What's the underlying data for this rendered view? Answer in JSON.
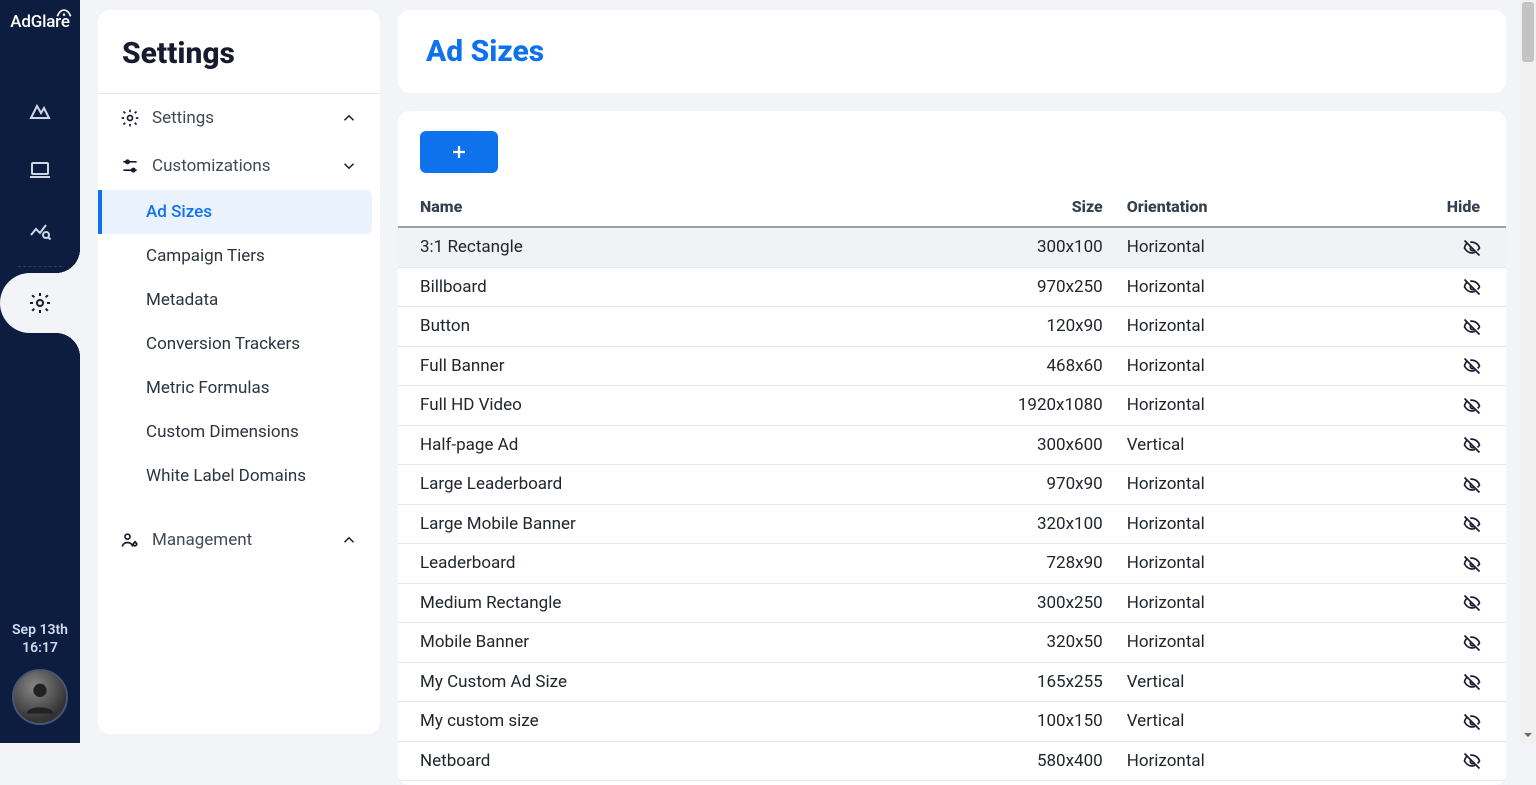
{
  "brand": "AdGlare",
  "date_line1": "Sep 13th",
  "date_line2": "16:17",
  "sidebar": {
    "title": "Settings",
    "sections": {
      "settings": {
        "label": "Settings"
      },
      "customizations": {
        "label": "Customizations"
      },
      "management": {
        "label": "Management"
      }
    },
    "items": [
      "Ad Sizes",
      "Campaign Tiers",
      "Metadata",
      "Conversion Trackers",
      "Metric Formulas",
      "Custom Dimensions",
      "White Label Domains"
    ]
  },
  "page": {
    "title": "Ad Sizes"
  },
  "table": {
    "headers": {
      "name": "Name",
      "size": "Size",
      "orientation": "Orientation",
      "hide": "Hide"
    },
    "rows": [
      {
        "name": "3:1 Rectangle",
        "size": "300x100",
        "orientation": "Horizontal"
      },
      {
        "name": "Billboard",
        "size": "970x250",
        "orientation": "Horizontal"
      },
      {
        "name": "Button",
        "size": "120x90",
        "orientation": "Horizontal"
      },
      {
        "name": "Full Banner",
        "size": "468x60",
        "orientation": "Horizontal"
      },
      {
        "name": "Full HD Video",
        "size": "1920x1080",
        "orientation": "Horizontal"
      },
      {
        "name": "Half-page Ad",
        "size": "300x600",
        "orientation": "Vertical"
      },
      {
        "name": "Large Leaderboard",
        "size": "970x90",
        "orientation": "Horizontal"
      },
      {
        "name": "Large Mobile Banner",
        "size": "320x100",
        "orientation": "Horizontal"
      },
      {
        "name": "Leaderboard",
        "size": "728x90",
        "orientation": "Horizontal"
      },
      {
        "name": "Medium Rectangle",
        "size": "300x250",
        "orientation": "Horizontal"
      },
      {
        "name": "Mobile Banner",
        "size": "320x50",
        "orientation": "Horizontal"
      },
      {
        "name": "My Custom Ad Size",
        "size": "165x255",
        "orientation": "Vertical"
      },
      {
        "name": "My custom size",
        "size": "100x150",
        "orientation": "Vertical"
      },
      {
        "name": "Netboard",
        "size": "580x400",
        "orientation": "Horizontal"
      }
    ]
  }
}
